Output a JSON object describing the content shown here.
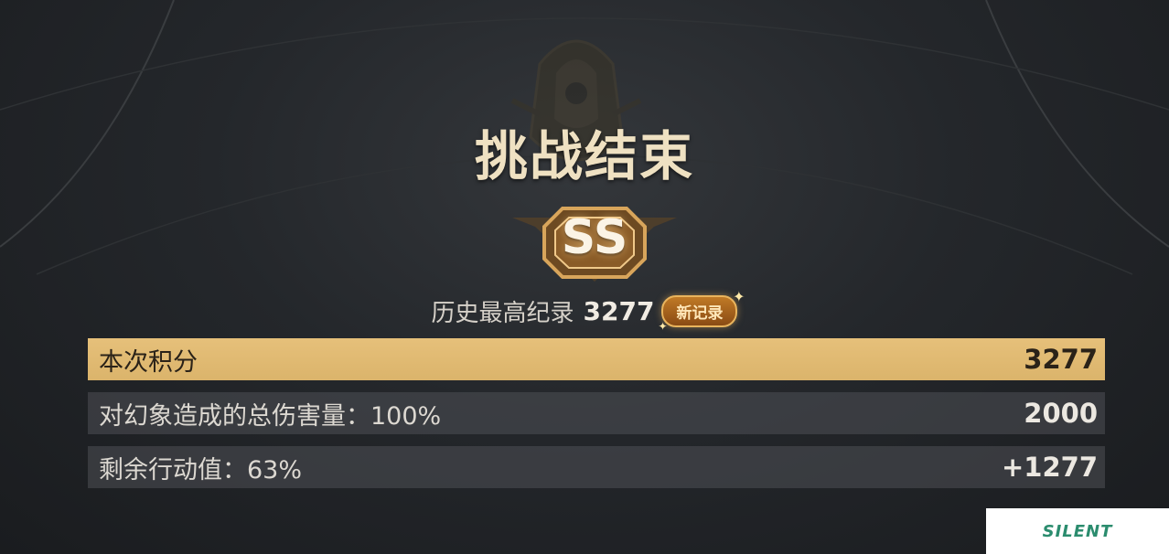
{
  "header": {
    "title": "挑战结束"
  },
  "rank": {
    "grade": "SS"
  },
  "record": {
    "label": "历史最高纪录",
    "value": "3277",
    "badge": "新记录"
  },
  "score_rows": [
    {
      "label": "本次积分",
      "value": "3277"
    },
    {
      "label": "对幻象造成的总伤害量：100%",
      "value": "2000"
    },
    {
      "label": "剩余行动值：63%",
      "value": "+1277"
    }
  ],
  "watermark": {
    "text": "SILENT"
  },
  "colors": {
    "gold": "#e6c07a",
    "badge": "#a0601d",
    "row_bg": "#4e5056"
  },
  "icons": [
    "emblem-icon",
    "rank-badge-icon",
    "sparkle-icon"
  ]
}
